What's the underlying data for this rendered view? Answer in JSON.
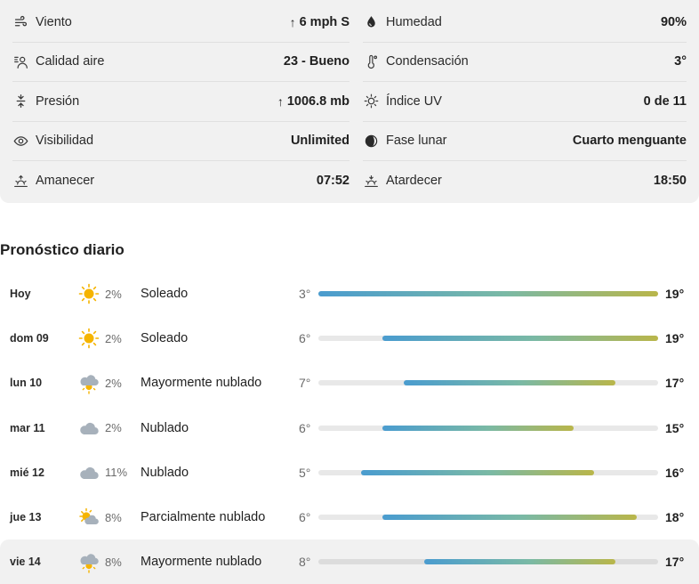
{
  "details": {
    "left": [
      {
        "icon": "wind-icon",
        "label": "Viento",
        "value": "6 mph S",
        "arrow": "↑"
      },
      {
        "icon": "air-quality-icon",
        "label": "Calidad aire",
        "value": "23 - Bueno",
        "arrow": ""
      },
      {
        "icon": "pressure-icon",
        "label": "Presión",
        "value": "1006.8 mb",
        "arrow": "↑"
      },
      {
        "icon": "eye-icon",
        "label": "Visibilidad",
        "value": "Unlimited",
        "arrow": ""
      },
      {
        "icon": "sunrise-icon",
        "label": "Amanecer",
        "value": "07:52",
        "arrow": ""
      }
    ],
    "right": [
      {
        "icon": "drop-icon",
        "label": "Humedad",
        "value": "90%",
        "arrow": ""
      },
      {
        "icon": "thermometer-icon",
        "label": "Condensación",
        "value": "3°",
        "arrow": ""
      },
      {
        "icon": "uv-icon",
        "label": "Índice UV",
        "value": "0 de 11",
        "arrow": ""
      },
      {
        "icon": "moon-phase-icon",
        "label": "Fase lunar",
        "value": "Cuarto menguante",
        "arrow": ""
      },
      {
        "icon": "sunset-icon",
        "label": "Atardecer",
        "value": "18:50",
        "arrow": ""
      }
    ]
  },
  "daily": {
    "title": "Pronóstico diario",
    "range_min": 3,
    "range_max": 19,
    "days": [
      {
        "name": "Hoy",
        "icon": "sun-icon",
        "precip": "2%",
        "condition": "Soleado",
        "low": "3°",
        "high": "19°",
        "low_val": 3,
        "high_val": 19
      },
      {
        "name": "dom 09",
        "icon": "sun-icon",
        "precip": "2%",
        "condition": "Soleado",
        "low": "6°",
        "high": "19°",
        "low_val": 6,
        "high_val": 19
      },
      {
        "name": "lun 10",
        "icon": "cloud-sun-icon",
        "precip": "2%",
        "condition": "Mayormente nublado",
        "low": "7°",
        "high": "17°",
        "low_val": 7,
        "high_val": 17
      },
      {
        "name": "mar 11",
        "icon": "cloud-icon",
        "precip": "2%",
        "condition": "Nublado",
        "low": "6°",
        "high": "15°",
        "low_val": 6,
        "high_val": 15
      },
      {
        "name": "mié 12",
        "icon": "cloud-icon",
        "precip": "11%",
        "condition": "Nublado",
        "low": "5°",
        "high": "16°",
        "low_val": 5,
        "high_val": 16
      },
      {
        "name": "jue 13",
        "icon": "partly-cloudy-icon",
        "precip": "8%",
        "condition": "Parcialmente nublado",
        "low": "6°",
        "high": "18°",
        "low_val": 6,
        "high_val": 18
      },
      {
        "name": "vie 14",
        "icon": "cloud-sun-icon",
        "precip": "8%",
        "condition": "Mayormente nublado",
        "low": "8°",
        "high": "17°",
        "low_val": 8,
        "high_val": 17
      }
    ]
  },
  "colors": {
    "sun": "#f5b400",
    "cloud": "#a7b1bb",
    "bar_start": "#4a9ccf",
    "bar_end": "#b9b64a"
  }
}
